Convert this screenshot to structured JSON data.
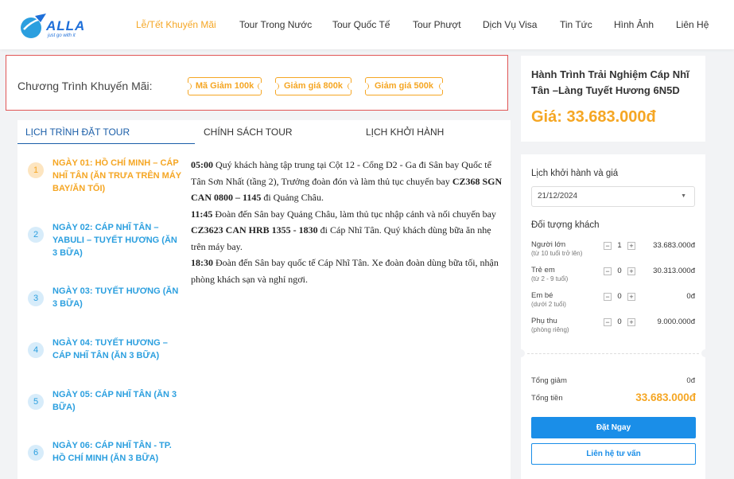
{
  "header": {
    "logo_text": "ALLA",
    "logo_tagline": "just go with it",
    "nav": [
      {
        "label": "Lễ/Tết Khuyến Mãi",
        "active": true
      },
      {
        "label": "Tour Trong Nước"
      },
      {
        "label": "Tour Quốc Tế"
      },
      {
        "label": "Tour Phượt"
      },
      {
        "label": "Dịch Vụ Visa"
      },
      {
        "label": "Tin Tức"
      },
      {
        "label": "Hình Ảnh"
      },
      {
        "label": "Liên Hệ"
      }
    ]
  },
  "promo": {
    "label": "Chương Trình Khuyến Mãi:",
    "coupons": [
      "Mã Giảm 100k",
      "Giảm giá 800k",
      "Giảm giá 500k"
    ]
  },
  "tabs": [
    "LỊCH TRÌNH ĐẶT TOUR",
    "CHÍNH SÁCH TOUR",
    "LỊCH KHỞI HÀNH"
  ],
  "days": [
    {
      "num": "1",
      "label": "NGÀY 01: HỒ CHÍ MINH – CÁP NHĨ TÂN (ĂN TRƯA TRÊN MÁY BAY/ĂN TỐI)"
    },
    {
      "num": "2",
      "label": "NGÀY 02: CÁP NHĨ TÂN – YABULI – TUYẾT HƯƠNG (ĂN 3 BỮA)"
    },
    {
      "num": "3",
      "label": "NGÀY 03: TUYẾT HƯƠNG (ĂN 3 BỮA)"
    },
    {
      "num": "4",
      "label": "NGÀY 04: TUYẾT HƯƠNG – CÁP NHĨ TÂN (ĂN 3 BỮA)"
    },
    {
      "num": "5",
      "label": "NGÀY 05: CÁP NHĨ TÂN (ĂN 3 BỮA)"
    },
    {
      "num": "6",
      "label": "NGÀY 06: CÁP NHĨ TÂN - TP. HỒ CHÍ MINH (ĂN 3 BỮA)"
    }
  ],
  "itinerary": {
    "p1_time": "05:00",
    "p1_text_a": " Quý khách hàng tập trung tại Cột 12 - Cổng D2 - Ga đi Sân bay Quốc tế Tân Sơn Nhất (tầng 2), Trưởng đoàn đón và làm thủ tục chuyến bay ",
    "p1_flight": "CZ368 SGN CAN 0800 – 1145",
    "p1_text_b": " đi Quảng Châu.",
    "p2_time": "11:45",
    "p2_text_a": " Đoàn đến Sân bay Quảng Châu, làm thủ tục nhập cảnh và nối chuyến bay ",
    "p2_flight": "CZ3623 CAN HRB 1355 - 1830",
    "p2_text_b": " đi Cáp Nhĩ Tân. Quý khách dùng bữa ăn nhẹ trên máy bay.",
    "p3_time": "18:30",
    "p3_text": " Đoàn đến Sân bay quốc tế Cáp Nhĩ Tân. Xe đoàn đoàn dùng bữa tối, nhận phòng khách sạn và nghỉ ngơi."
  },
  "tour": {
    "title": "Hành Trình Trải Nghiệm Cáp Nhĩ Tân –Làng Tuyết Hương 6N5D",
    "price": "Giá: 33.683.000đ"
  },
  "booking": {
    "date_label": "Lịch khởi hành và giá",
    "date_value": "21/12/2024",
    "pax_label": "Đối tượng khách",
    "pax": [
      {
        "name": "Người lớn",
        "note": "(từ 10 tuổi trở lên)",
        "qty": "1",
        "price": "33.683.000đ"
      },
      {
        "name": "Trẻ em",
        "note": "(từ 2 - 9 tuổi)",
        "qty": "0",
        "price": "30.313.000đ"
      },
      {
        "name": "Em bé",
        "note": "(dưới 2 tuổi)",
        "qty": "0",
        "price": "0đ"
      },
      {
        "name": "Phụ thu",
        "note": "(phòng riêng)",
        "qty": "0",
        "price": "9.000.000đ"
      }
    ],
    "discount_label": "Tổng giảm",
    "discount_value": "0đ",
    "total_label": "Tổng tiền",
    "total_value": "33.683.000đ",
    "book_button": "Đặt Ngay",
    "consult_button": "Liên hệ tư vấn"
  },
  "colors": {
    "accent": "#f5a623",
    "primary": "#1a8ee8",
    "day_blue": "#2b9fdf",
    "promo_border": "#e05555"
  }
}
